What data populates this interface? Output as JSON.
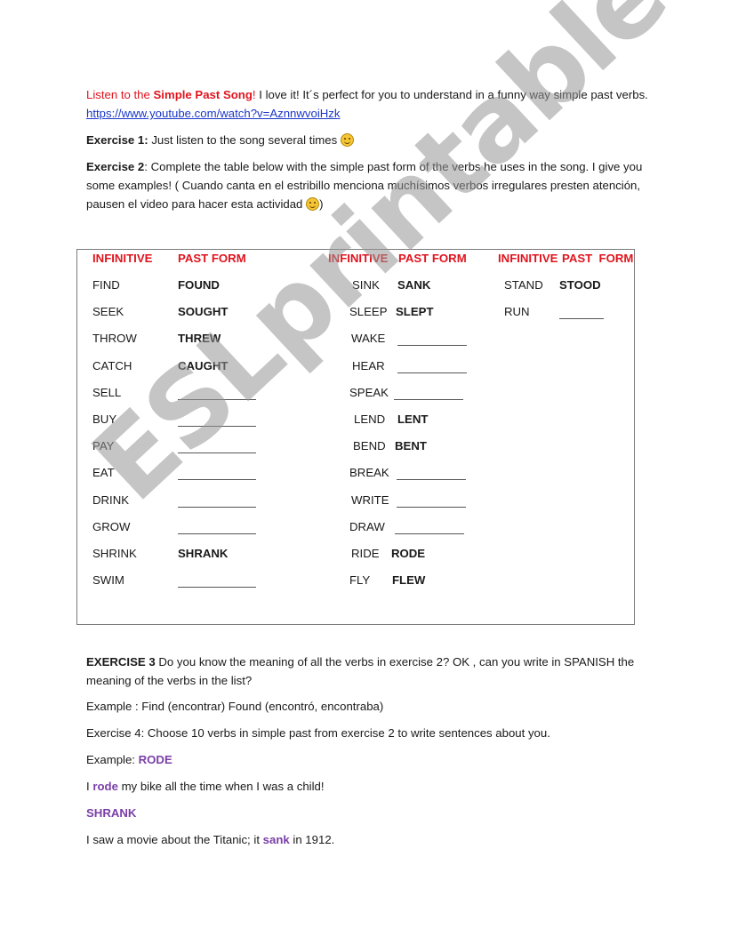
{
  "intro": {
    "listen_prefix": "Listen to the ",
    "song_title": "Simple Past Song",
    "exclaim": "!",
    "rest": " I love it! It´s perfect for you to understand in a funny way simple past verbs.  ",
    "link": "https://www.youtube.com/watch?v=AznnwvoiHzk"
  },
  "exercise1": {
    "label": "Exercise 1:",
    "text": " Just listen to the song several times ",
    "emoji": "smiling-face-icon"
  },
  "exercise2": {
    "label": "Exercise 2",
    "text": ": Complete the table below with the simple past form of the verbs he uses in the song. I give you some examples! ( Cuando canta en el estribillo menciona muchísimos verbos irregulares presten atención, pausen el video para hacer esta actividad ",
    "close": ")",
    "emoji": "smiling-face-icon"
  },
  "table": {
    "headers": {
      "infinitive": "INFINITIVE",
      "past_form": "PAST FORM",
      "past_form_spaced": "PAST  FORM"
    },
    "col1": [
      {
        "inf": "FIND",
        "past": "FOUND"
      },
      {
        "inf": "SEEK",
        "past": "SOUGHT"
      },
      {
        "inf": "THROW",
        "past": "THREW"
      },
      {
        "inf": "CATCH",
        "past": "CAUGHT"
      },
      {
        "inf": "SELL",
        "past": ""
      },
      {
        "inf": "BUY",
        "past": ""
      },
      {
        "inf": "PAY",
        "past": ""
      },
      {
        "inf": "EAT",
        "past": ""
      },
      {
        "inf": "DRINK",
        "past": ""
      },
      {
        "inf": "GROW",
        "past": ""
      },
      {
        "inf": "SHRINK",
        "past": "SHRANK"
      },
      {
        "inf": "SWIM",
        "past": ""
      }
    ],
    "col2": [
      {
        "inf": "SINK",
        "past": "SANK"
      },
      {
        "inf": "SLEEP",
        "past": "SLEPT"
      },
      {
        "inf": "WAKE",
        "past": ""
      },
      {
        "inf": "HEAR",
        "past": ""
      },
      {
        "inf": "SPEAK",
        "past": ""
      },
      {
        "inf": "LEND",
        "past": "LENT"
      },
      {
        "inf": "BEND",
        "past": "BENT"
      },
      {
        "inf": "BREAK",
        "past": ""
      },
      {
        "inf": "WRITE",
        "past": ""
      },
      {
        "inf": "DRAW",
        "past": ""
      },
      {
        "inf": "RIDE",
        "past": "RODE"
      },
      {
        "inf": "FLY",
        "past": "FLEW"
      }
    ],
    "col3": [
      {
        "inf": "STAND",
        "past": "STOOD"
      },
      {
        "inf": "RUN",
        "past": ""
      }
    ]
  },
  "exercise3": {
    "label": "EXERCISE 3",
    "text": " Do you know the meaning of all the verbs in exercise 2? OK , can you write in SPANISH the meaning of the verbs in the list?",
    "example": "Example : Find (encontrar) Found (encontró, encontraba)"
  },
  "exercise4": {
    "text": "Exercise 4:  Choose 10 verbs in simple past from exercise 2 to write sentences about you.",
    "example_label": "Example: ",
    "example_word": "RODE",
    "sentence1_pre": "I ",
    "sentence1_word": "rode",
    "sentence1_post": " my bike all the time when I was a child!",
    "word2": "SHRANK",
    "sentence2_pre": "I saw a movie about the Titanic; it ",
    "sentence2_word": "sank",
    "sentence2_post": " in 1912."
  },
  "watermark": "ESLprintables.com",
  "colors": {
    "header_red": "#e0141e",
    "link_blue": "#1a36c8",
    "highlight_purple": "#7a3fa8"
  }
}
